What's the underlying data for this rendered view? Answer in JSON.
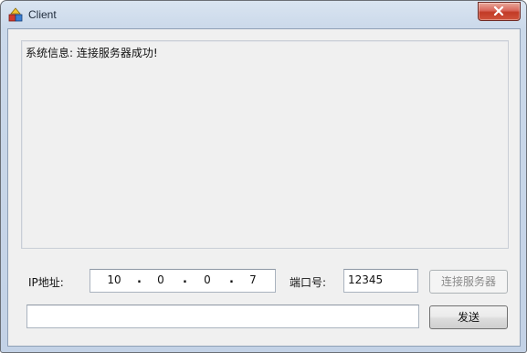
{
  "window": {
    "title": "Client",
    "app_icon": "shapes-app-icon",
    "close_icon": "close-icon"
  },
  "log": {
    "lines": [
      "系统信息: 连接服务器成功!"
    ]
  },
  "connection": {
    "ip_label": "IP地址:",
    "ip_octets": [
      "10",
      "0",
      "0",
      "7"
    ],
    "port_label": "端口号:",
    "port_value": "12345",
    "connect_button": "连接服务器",
    "connect_button_enabled": false
  },
  "message": {
    "input_value": "",
    "send_button": "发送"
  },
  "colors": {
    "close_button": "#c23a26",
    "window_frame": "#c3d2e6",
    "client_bg": "#f0f0f0"
  }
}
